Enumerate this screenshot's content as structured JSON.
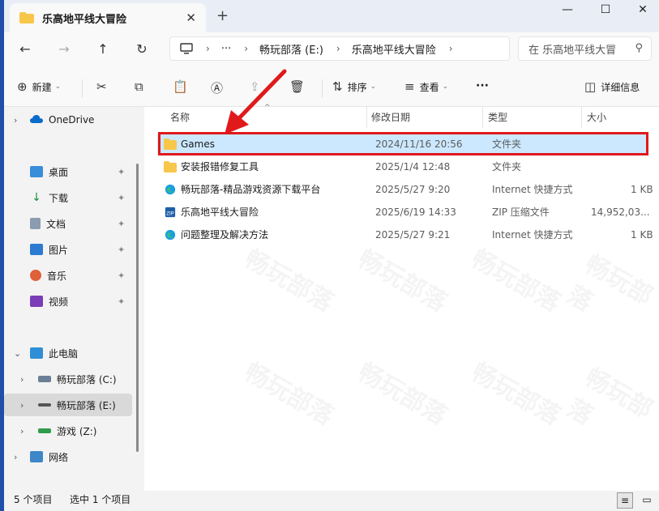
{
  "tab": {
    "title": "乐高地平线大冒险",
    "close": "✕",
    "new": "+"
  },
  "window": {
    "minimize": "—",
    "maximize": "☐",
    "close": "✕"
  },
  "address": {
    "pc_icon": "monitor-icon",
    "more": "···",
    "crumbs": [
      "畅玩部落 (E:)",
      "乐高地平线大冒险"
    ],
    "separator": "›"
  },
  "search": {
    "placeholder": "在 乐高地平线大冒"
  },
  "toolbar": {
    "new_label": "新建",
    "sort_label": "排序",
    "view_label": "查看",
    "more": "···",
    "details_label": "详细信息"
  },
  "sidebar": {
    "onedrive": "OneDrive",
    "quick": [
      "桌面",
      "下载",
      "文档",
      "图片",
      "音乐",
      "视频"
    ],
    "this_pc": "此电脑",
    "drives": [
      "畅玩部落 (C:)",
      "畅玩部落 (E:)",
      "游戏 (Z:)"
    ],
    "network": "网络"
  },
  "columns": {
    "name": "名称",
    "modified": "修改日期",
    "type": "类型",
    "size": "大小"
  },
  "files": [
    {
      "name": "Games",
      "modified": "2024/11/16 20:56",
      "type": "文件夹",
      "size": "",
      "icon": "folder-icon"
    },
    {
      "name": "安装报错修复工具",
      "modified": "2025/1/4 12:48",
      "type": "文件夹",
      "size": "",
      "icon": "folder-icon"
    },
    {
      "name": "畅玩部落-精品游戏资源下载平台",
      "modified": "2025/5/27 9:20",
      "type": "Internet 快捷方式",
      "size": "1 KB",
      "icon": "edge-shortcut-icon"
    },
    {
      "name": "乐高地平线大冒险",
      "modified": "2025/6/19 14:33",
      "type": "ZIP 压缩文件",
      "size": "14,952,03...",
      "icon": "zip-icon"
    },
    {
      "name": "问题整理及解决方法",
      "modified": "2025/5/27 9:21",
      "type": "Internet 快捷方式",
      "size": "1 KB",
      "icon": "edge-shortcut-icon"
    }
  ],
  "status": {
    "count": "5 个项目",
    "selected": "选中 1 个项目"
  },
  "watermark": "畅玩部落",
  "colors": {
    "accent": "#0067c0",
    "selection": "#cce8ff",
    "highlight": "#e0191b",
    "folder": "#f8c74a"
  }
}
